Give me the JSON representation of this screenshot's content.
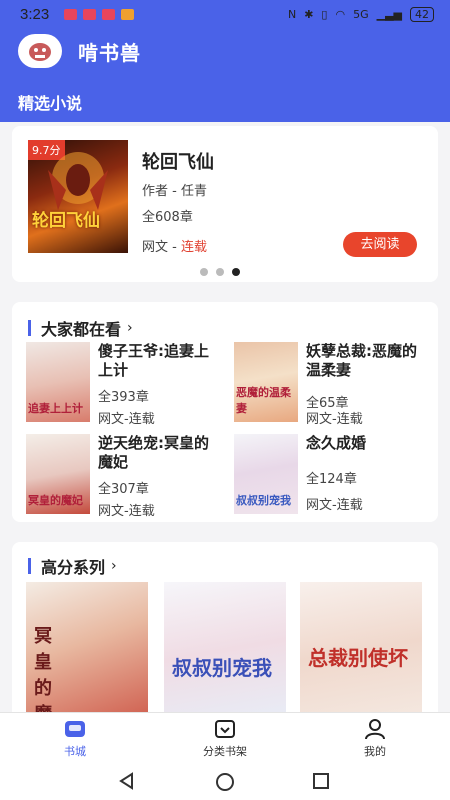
{
  "status": {
    "time": "3:23",
    "battery": "42",
    "net": "5G"
  },
  "header": {
    "app_title": "啃书兽",
    "tab": "精选小说"
  },
  "featured": {
    "score": "9.7分",
    "cover_text": "轮回飞仙",
    "title": "轮回飞仙",
    "author": "作者 - 任青",
    "chapters": "全608章",
    "genre": "网文 - ",
    "status": "连载",
    "read_button": "去阅读"
  },
  "popular": {
    "title": "大家都在看",
    "books": [
      {
        "title": "傻子王爷:追妻上上计",
        "cover_text": "追妻上上计",
        "chapters": "全393章",
        "meta": "网文-连载"
      },
      {
        "title": "妖孽总裁:恶魔的温柔妻",
        "cover_text": "恶魔的温柔妻",
        "chapters": "全65章",
        "meta": "网文-连载"
      },
      {
        "title": "逆天绝宠:冥皇的魔妃",
        "cover_text": "冥皇的魔妃",
        "chapters": "全307章",
        "meta": "网文-连载"
      },
      {
        "title": "念久成婚",
        "cover_text": "叔叔别宠我",
        "chapters": "全124章",
        "meta": "网文-连载"
      }
    ]
  },
  "high": {
    "title": "高分系列",
    "covers": [
      "冥皇的魔妃",
      "叔叔别宠我",
      "总裁别使坏"
    ]
  },
  "nav": {
    "items": [
      {
        "label": "书城",
        "icon": "store-icon"
      },
      {
        "label": "分类书架",
        "icon": "bookshelf-icon"
      },
      {
        "label": "我的",
        "icon": "profile-icon"
      }
    ]
  },
  "colors": {
    "primary": "#4a62e8",
    "accent": "#e8452c"
  }
}
